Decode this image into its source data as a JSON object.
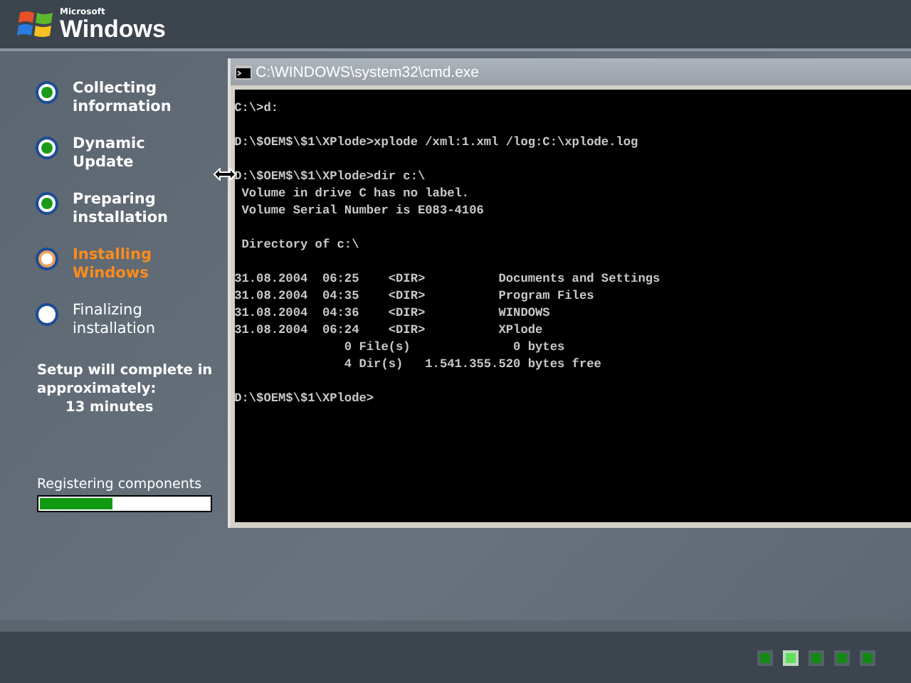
{
  "header": {
    "brand_small": "Microsoft",
    "brand": "Windows"
  },
  "steps": [
    {
      "label": "Collecting information",
      "kind": "done"
    },
    {
      "label": "Dynamic Update",
      "kind": "done"
    },
    {
      "label": "Preparing installation",
      "kind": "done"
    },
    {
      "label": "Installing Windows",
      "kind": "current"
    },
    {
      "label": "Finalizing installation",
      "kind": "pending"
    }
  ],
  "estimate": {
    "text": "Setup will complete in approximately:",
    "time": "13 minutes"
  },
  "progress": {
    "label": "Registering components",
    "level": 0.43
  },
  "console": {
    "title": "C:\\WINDOWS\\system32\\cmd.exe",
    "blocks": [
      [
        "C:\\>d:"
      ],
      [
        "D:\\$OEM$\\$1\\XPlode>xplode /xml:1.xml /log:C:\\xplode.log"
      ],
      [
        "D:\\$OEM$\\$1\\XPlode>dir c:\\",
        " Volume in drive C has no label.",
        " Volume Serial Number is E083-4106"
      ],
      [
        " Directory of c:\\"
      ],
      [
        "31.08.2004  06:25    <DIR>          Documents and Settings",
        "31.08.2004  04:35    <DIR>          Program Files",
        "31.08.2004  04:36    <DIR>          WINDOWS",
        "31.08.2004  06:24    <DIR>          XPlode",
        "               0 File(s)              0 bytes",
        "               4 Dir(s)   1.541.355.520 bytes free"
      ],
      [
        "D:\\$OEM$\\$1\\XPlode>"
      ]
    ]
  },
  "page_dots": [
    {
      "selected": false
    },
    {
      "selected": true
    },
    {
      "selected": false
    },
    {
      "selected": false
    },
    {
      "selected": false
    }
  ]
}
